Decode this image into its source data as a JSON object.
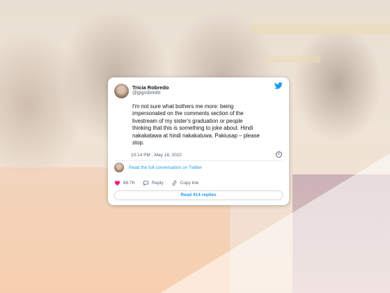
{
  "tweet": {
    "display_name": "Tricia Robredo",
    "handle": "@jpgrobredo",
    "text": "I'm not sure what bothers me more: being\nimpersonated on the comments section of the\nlivestream of my sister's graduation or people\nthinking that this is something to joke about. Hindi\nnakakatawa at hindi nakakatuwa. Pakiusap – please\nstop.",
    "timestamp": "10:14 PM · May 18, 2022",
    "full_conversation_link": "Read the full conversation on Twitter",
    "likes": "88.7K",
    "reply_label": "Reply",
    "copy_link_label": "Copy link",
    "read_replies": "Read 414 replies"
  },
  "icons": {
    "brand": "twitter-bird-icon",
    "info": "info-icon",
    "like": "heart-icon",
    "reply": "speech-bubble-icon",
    "copy_link": "link-icon"
  },
  "colors": {
    "accent": "#1d9bf0",
    "like": "#f91880",
    "muted": "#536471"
  }
}
